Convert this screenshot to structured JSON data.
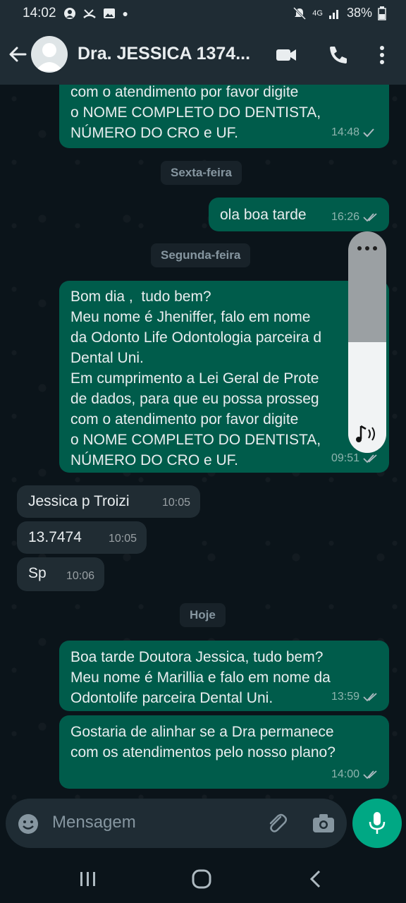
{
  "status_bar": {
    "time": "14:02",
    "network": "4G",
    "battery": "38%"
  },
  "header": {
    "contact_name": "Dra. JESSICA 1374..."
  },
  "messages": [
    {
      "dir": "out",
      "text": "com o atendimento por favor digite\no NOME COMPLETO DO DENTISTA,\nNÚMERO DO CRO e UF.",
      "time": "14:48",
      "status": "sent"
    },
    {
      "date": "Sexta-feira"
    },
    {
      "dir": "out",
      "text": "ola boa tarde",
      "time": "16:26",
      "status": "delivered"
    },
    {
      "date": "Segunda-feira"
    },
    {
      "dir": "out",
      "text": "Bom dia ,  tudo bem?\nMeu nome é Jheniffer, falo em nome\nda Odonto Life Odontologia parceira d\nDental Uni.\nEm cumprimento a Lei Geral de Prote\nde dados, para que eu possa prosseg\ncom o atendimento por favor digite\no NOME COMPLETO DO DENTISTA,\nNÚMERO DO CRO e UF.",
      "time": "09:51",
      "status": "delivered"
    },
    {
      "dir": "in",
      "text": "Jessica p Troizi",
      "time": "10:05"
    },
    {
      "dir": "in",
      "text": "13.7474",
      "time": "10:05"
    },
    {
      "dir": "in",
      "text": "Sp",
      "time": "10:06"
    },
    {
      "date": "Hoje"
    },
    {
      "dir": "out",
      "text": "Boa tarde Doutora Jessica, tudo bem?\nMeu nome é Marillia e falo em nome da\nOdontolife parceira Dental Uni.",
      "time": "13:59",
      "status": "delivered"
    },
    {
      "dir": "out",
      "text": "Gostaria de alinhar se a Dra permanece\ncom os atendimentos pelo nosso plano?",
      "time": "14:00",
      "status": "delivered"
    }
  ],
  "volume_overlay": {
    "level": 0.5,
    "menu_icon": "more-dots-icon",
    "sound_icon": "music-note-icon"
  },
  "composer": {
    "placeholder": "Mensagem"
  },
  "colors": {
    "outgoing": "#005c4b",
    "incoming": "#202c33",
    "accent": "#00a884",
    "background": "#0b141a"
  }
}
